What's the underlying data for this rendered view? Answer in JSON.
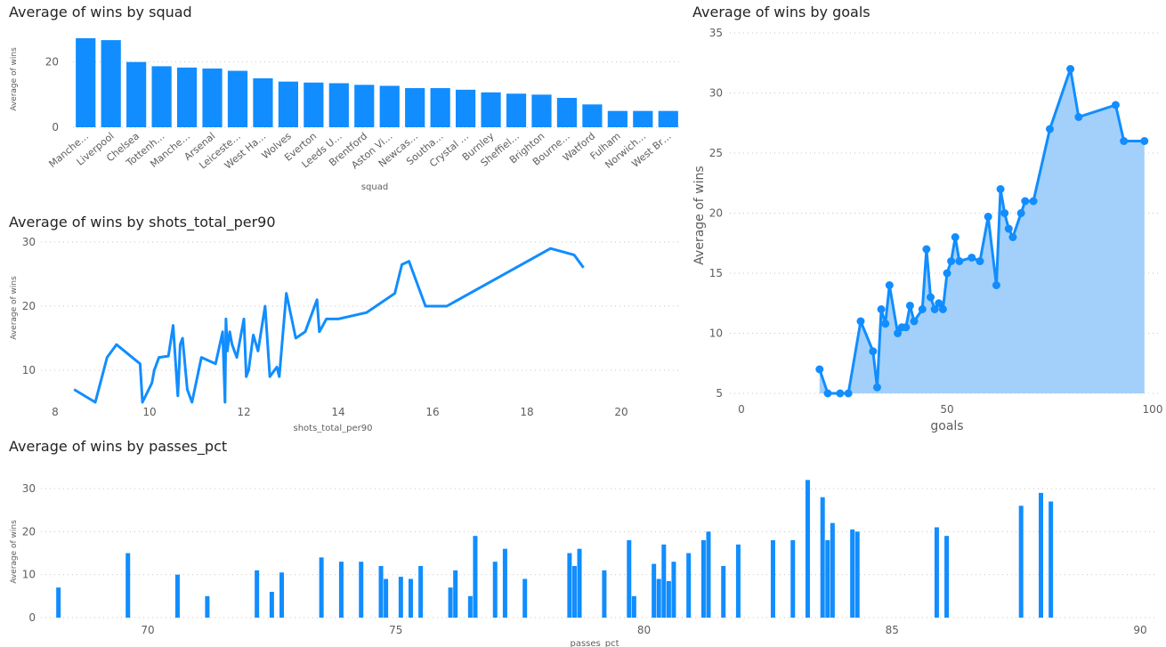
{
  "colors": {
    "series": "#118dff",
    "area": "#a2d0fb",
    "title": "#252423",
    "axis_text": "#605e5c",
    "grid": "#c8c6c4"
  },
  "chart_data": [
    {
      "type": "bar",
      "title": "Average of wins by squad",
      "xlabel": "squad",
      "ylabel": "Average of wins",
      "ylim": [
        0,
        30
      ],
      "yticks": [
        0,
        20
      ],
      "grid": true,
      "categories": [
        "Manche…",
        "Liverpool",
        "Chelsea",
        "Tottenh…",
        "Manche…",
        "Arsenal",
        "Leiceste…",
        "West Ha…",
        "Wolves",
        "Everton",
        "Leeds U…",
        "Brentford",
        "Aston Vi…",
        "Newcas…",
        "Southa…",
        "Crystal …",
        "Burnley",
        "Sheffiel…",
        "Brighton",
        "Bourne…",
        "Watford",
        "Fulham",
        "Norwich…",
        "West Br…"
      ],
      "values": [
        27.3,
        26.7,
        20,
        18.7,
        18.3,
        18,
        17.3,
        15,
        14,
        13.7,
        13.5,
        13,
        12.7,
        12,
        12,
        11.5,
        10.7,
        10.3,
        10,
        9,
        7,
        5,
        5,
        5
      ]
    },
    {
      "type": "line",
      "title": "Average of wins by shots_total_per90",
      "xlabel": "shots_total_per90",
      "ylabel": "Average of wins",
      "xlim": [
        8,
        21
      ],
      "ylim": [
        5,
        30
      ],
      "xticks": [
        8,
        10,
        12,
        14,
        16,
        18,
        20
      ],
      "yticks": [
        10,
        20,
        30
      ],
      "grid": true,
      "x": [
        8.4,
        8.85,
        9.1,
        9.3,
        9.8,
        9.85,
        10.05,
        10.1,
        10.2,
        10.4,
        10.5,
        10.6,
        10.65,
        10.7,
        10.8,
        10.9,
        11.1,
        11.4,
        11.55,
        11.6,
        11.62,
        11.65,
        11.7,
        11.75,
        11.85,
        12.0,
        12.05,
        12.1,
        12.2,
        12.3,
        12.45,
        12.55,
        12.7,
        12.75,
        12.9,
        13.1,
        13.3,
        13.55,
        13.6,
        13.75,
        14.0,
        14.6,
        15.2,
        15.35,
        15.5,
        15.85,
        16.3,
        18.5,
        19.0,
        19.2
      ],
      "y": [
        7,
        5,
        12,
        14,
        11,
        5,
        8,
        10,
        12,
        12.2,
        17,
        6,
        14,
        15,
        7,
        5,
        12,
        11,
        16,
        5,
        18,
        13,
        16,
        14,
        12,
        18,
        9,
        10,
        15.5,
        13,
        20,
        9,
        10.5,
        9,
        22,
        15,
        16,
        21,
        16,
        18,
        18,
        19,
        22,
        26.5,
        27,
        20,
        20,
        29,
        28,
        26
      ]
    },
    {
      "type": "area",
      "title": "Average of wins by goals",
      "xlabel": "goals",
      "ylabel": "Average of wins",
      "xlim": [
        0,
        100
      ],
      "ylim": [
        5,
        35
      ],
      "xticks": [
        0,
        50,
        100
      ],
      "yticks": [
        5,
        10,
        15,
        20,
        25,
        30,
        35
      ],
      "grid": true,
      "markers": true,
      "x": [
        19,
        21,
        24,
        26,
        29,
        32,
        33,
        34,
        35,
        36,
        38,
        39,
        40,
        41,
        42,
        44,
        45,
        46,
        47,
        48,
        49,
        50,
        51,
        52,
        53,
        56,
        58,
        60,
        62,
        63,
        64,
        65,
        66,
        68,
        69,
        71,
        75,
        80,
        82,
        91,
        93,
        98
      ],
      "y": [
        7,
        5,
        5,
        5,
        11,
        8.5,
        5.5,
        12,
        10.8,
        14,
        10,
        10.5,
        10.5,
        12.3,
        11,
        12,
        17,
        13,
        12,
        12.5,
        12,
        15,
        16,
        18,
        16,
        16.3,
        16,
        19.7,
        14,
        22,
        20,
        18.7,
        18,
        20,
        21,
        21,
        27,
        32,
        28,
        29,
        26,
        26
      ]
    },
    {
      "type": "bar",
      "title": "Average of wins by passes_pct",
      "xlabel": "passes_pct",
      "ylabel": "Average of wins",
      "xlim": [
        68,
        90
      ],
      "ylim": [
        0,
        32
      ],
      "xticks": [
        70,
        75,
        80,
        85,
        90
      ],
      "yticks": [
        0,
        10,
        20,
        30
      ],
      "grid": true,
      "x": [
        68.2,
        69.6,
        70.6,
        71.2,
        72.2,
        72.5,
        72.7,
        73.5,
        73.9,
        74.3,
        74.7,
        74.8,
        75.1,
        75.3,
        75.5,
        76.1,
        76.2,
        76.5,
        76.6,
        77.0,
        77.2,
        77.6,
        78.5,
        78.6,
        78.7,
        79.2,
        79.7,
        79.8,
        80.2,
        80.3,
        80.4,
        80.5,
        80.6,
        80.9,
        81.2,
        81.3,
        81.6,
        81.9,
        82.6,
        83.0,
        83.3,
        83.6,
        83.7,
        83.8,
        84.2,
        84.3,
        85.9,
        86.1,
        87.6,
        88.0,
        88.2
      ],
      "values": [
        7,
        15,
        10,
        5,
        11,
        6,
        10.5,
        14,
        13,
        13,
        12,
        9,
        9.5,
        9,
        12,
        7,
        11,
        5,
        19,
        13,
        16,
        9,
        15,
        12,
        16,
        11,
        18,
        5,
        12.5,
        9,
        17,
        8.5,
        13,
        15,
        18,
        20,
        12,
        17,
        18,
        18,
        32,
        28,
        18,
        22,
        20.5,
        20,
        21,
        19,
        26,
        29,
        27
      ]
    }
  ]
}
